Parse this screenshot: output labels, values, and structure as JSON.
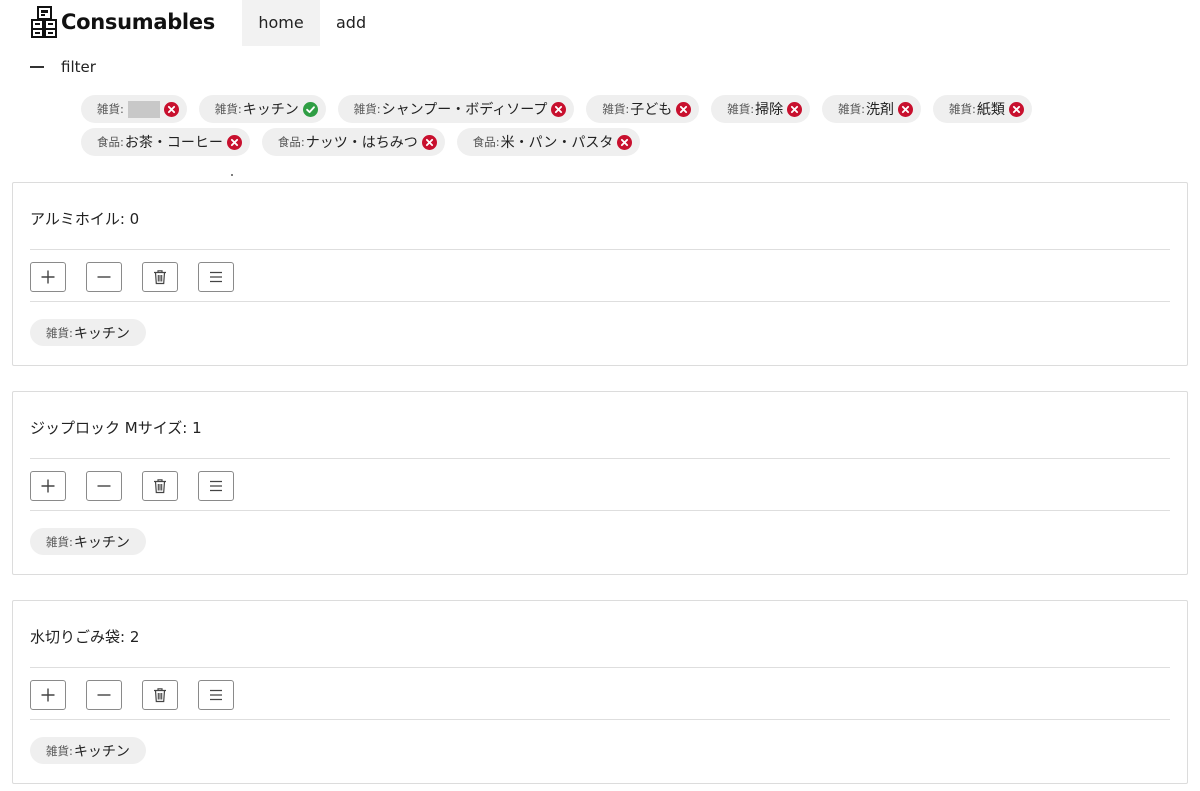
{
  "app": {
    "title": "Consumables",
    "logo_icon": "box-stack-icon"
  },
  "nav": {
    "home_label": "home",
    "add_label": "add"
  },
  "filter": {
    "label": "filter",
    "toggle_icon": "minus-icon",
    "chips": [
      {
        "category": "雑貨:",
        "name": "",
        "redacted": true,
        "status": "excluded"
      },
      {
        "category": "雑貨:",
        "name": "キッチン",
        "status": "included"
      },
      {
        "category": "雑貨:",
        "name": "シャンプー・ボディソープ",
        "status": "excluded"
      },
      {
        "category": "雑貨:",
        "name": "子ども",
        "status": "excluded"
      },
      {
        "category": "雑貨:",
        "name": "掃除",
        "status": "excluded"
      },
      {
        "category": "雑貨:",
        "name": "洗剤",
        "status": "excluded"
      },
      {
        "category": "雑貨:",
        "name": "紙類",
        "status": "excluded"
      },
      {
        "category": "食品:",
        "name": "お茶・コーヒー",
        "status": "excluded"
      },
      {
        "category": "食品:",
        "name": "ナッツ・はちみつ",
        "status": "excluded"
      },
      {
        "category": "食品:",
        "name": "米・パン・パスタ",
        "status": "excluded"
      }
    ]
  },
  "items": [
    {
      "title": "アルミホイル: 0",
      "tag_category": "雑貨:",
      "tag_name": "キッチン"
    },
    {
      "title": "ジップロック Mサイズ: 1",
      "tag_category": "雑貨:",
      "tag_name": "キッチン"
    },
    {
      "title": "水切りごみ袋: 2",
      "tag_category": "雑貨:",
      "tag_name": "キッチン"
    }
  ],
  "actions": {
    "increment_icon": "plus-icon",
    "decrement_icon": "minus-icon",
    "delete_icon": "trash-icon",
    "menu_icon": "menu-icon"
  },
  "colors": {
    "excluded": "#c8102e",
    "included": "#2f9e44",
    "chip_bg": "#efefef",
    "nav_active_bg": "#f2f2f2",
    "card_border": "#dcdcdc"
  }
}
